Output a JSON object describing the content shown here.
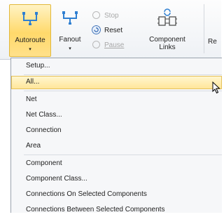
{
  "ribbon": {
    "autoroute_label": "Autoroute",
    "fanout_label": "Fanout",
    "stop_label": "Stop",
    "reset_label": "Reset",
    "pause_label": "Pause",
    "component_links_line1": "Component",
    "component_links_line2": "Links",
    "truncated_label": "Re",
    "dropdown_glyph": "▾",
    "icons": [
      "autoroute-icon",
      "fanout-icon",
      "stop-icon",
      "reset-icon",
      "pause-icon",
      "component-links-icon"
    ]
  },
  "menu": {
    "items": [
      "Setup...",
      "All...",
      "Net",
      "Net Class...",
      "Connection",
      "Area",
      "Component",
      "Component Class...",
      "Connections On Selected Components",
      "Connections Between Selected Components"
    ],
    "highlighted_item": "All..."
  },
  "colors": {
    "highlight": "#ffe69a",
    "highlight_border": "#e6c25a",
    "icon_blue": "#3b87d6",
    "menu_bg": "#f6f7f9"
  }
}
